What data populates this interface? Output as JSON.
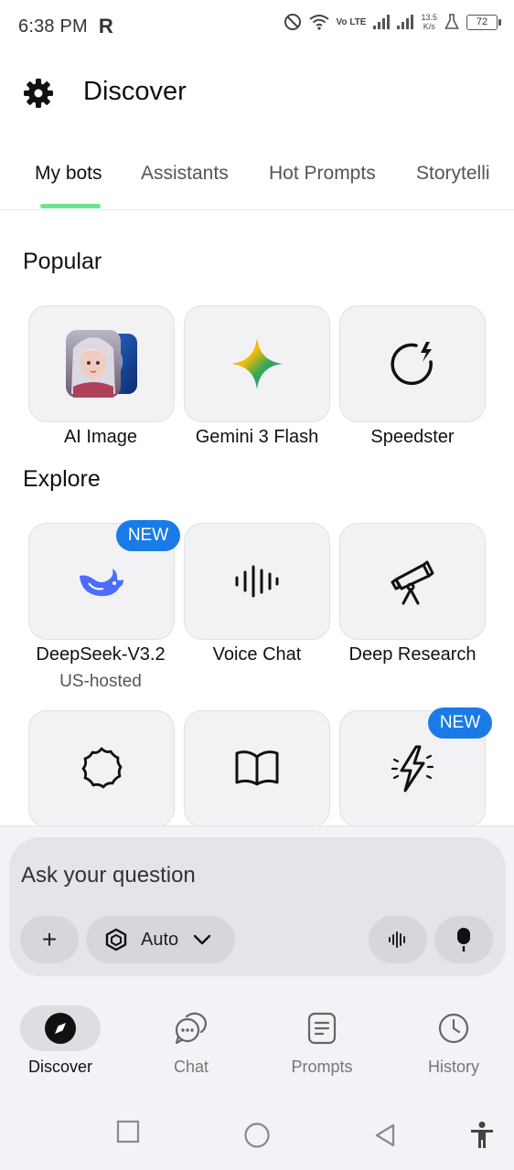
{
  "status_bar": {
    "time": "6:38 PM",
    "carrier_glyph": "R",
    "network": "Vo LTE",
    "speed_value": "13.5",
    "speed_unit": "K/s",
    "battery": "72"
  },
  "header": {
    "title": "Discover",
    "settings_icon": "gear-icon"
  },
  "tabs": [
    {
      "label": "My bots",
      "active": true
    },
    {
      "label": "Assistants",
      "active": false
    },
    {
      "label": "Hot Prompts",
      "active": false
    },
    {
      "label": "Storytelli",
      "active": false
    }
  ],
  "popular": {
    "title": "Popular",
    "items": [
      {
        "label": "AI Image",
        "icon": "ai-image-thumbnail"
      },
      {
        "label": "Gemini 3 Flash",
        "icon": "gemini-sparkle-icon"
      },
      {
        "label": "Speedster",
        "icon": "speedster-icon"
      }
    ]
  },
  "explore": {
    "title": "Explore",
    "items": [
      {
        "label": "DeepSeek-V3.2",
        "sublabel": "US-hosted",
        "badge": "NEW",
        "icon": "deepseek-whale-icon"
      },
      {
        "label": "Voice Chat",
        "icon": "waveform-icon"
      },
      {
        "label": "Deep Research",
        "icon": "telescope-icon"
      },
      {
        "label": "",
        "icon": "badge-shape-icon"
      },
      {
        "label": "",
        "icon": "book-icon"
      },
      {
        "label": "",
        "badge": "NEW",
        "icon": "lightning-icon"
      }
    ]
  },
  "composer": {
    "placeholder": "Ask your question",
    "add_label": "+",
    "model_label": "Auto",
    "model_icon": "hexagon-icon",
    "voice_icon": "waveform-icon",
    "mic_icon": "microphone-icon"
  },
  "bottom_nav": [
    {
      "label": "Discover",
      "icon": "compass-icon",
      "active": true
    },
    {
      "label": "Chat",
      "icon": "chat-bubbles-icon",
      "active": false
    },
    {
      "label": "Prompts",
      "icon": "document-icon",
      "active": false
    },
    {
      "label": "History",
      "icon": "clock-icon",
      "active": false
    }
  ],
  "colors": {
    "accent_indicator": "#6ee38f",
    "badge_blue": "#1a7be8",
    "deepseek_blue": "#4d6bfe"
  }
}
